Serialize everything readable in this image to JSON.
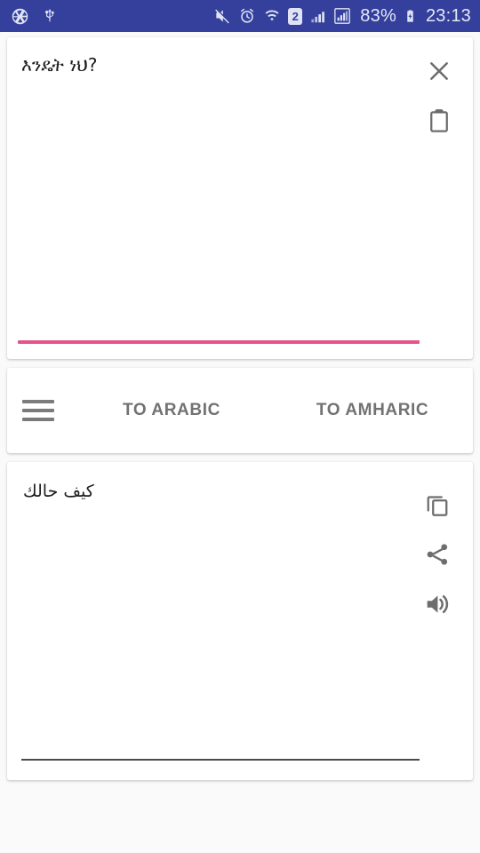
{
  "statusbar": {
    "background_color": "#34409c",
    "left_icons": [
      {
        "name": "camera-shutter-icon",
        "label": "camera"
      },
      {
        "name": "usb-icon",
        "label": "usb"
      }
    ],
    "right_icons": [
      {
        "name": "mute-icon",
        "label": "silent"
      },
      {
        "name": "alarm-clock-icon",
        "label": "alarm"
      },
      {
        "name": "wifi-icon",
        "label": "wifi"
      },
      {
        "name": "sim2-icon",
        "label": "2"
      },
      {
        "name": "signal-bars-icon",
        "label": "signal"
      },
      {
        "name": "signal-bars-boxed-icon",
        "label": "signal 2"
      }
    ],
    "battery_percent": "83%",
    "charging": true,
    "clock": "23:13"
  },
  "input_card": {
    "source_text": "እንዴት ነህ?",
    "clear_label": "clear",
    "paste_label": "paste",
    "accent_color": "#e8528c"
  },
  "tabs": {
    "menu_label": "menu",
    "to_arabic": "TO ARABIC",
    "to_amharic": "TO AMHARIC",
    "text_color": "#727272"
  },
  "output_card": {
    "translated_text": "كيف حالك",
    "copy_label": "copy",
    "share_label": "share",
    "speak_label": "listen",
    "underline_color": "#4a4a4a"
  }
}
